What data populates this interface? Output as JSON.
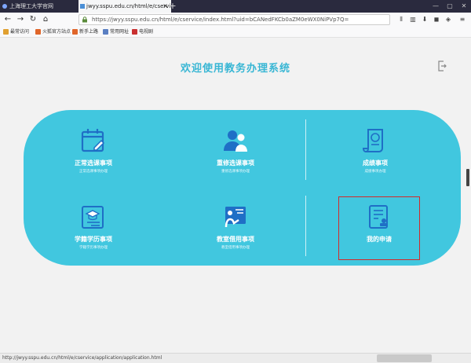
{
  "browser": {
    "tabs": [
      {
        "label": "上海理工大学官网"
      },
      {
        "label": "jwyy.sspu.edu.cn/html/e/cservice/"
      }
    ],
    "nav": {
      "back": "←",
      "forward": "→",
      "reload": "↻",
      "home": "⌂"
    },
    "url": "https://jwyy.sspu.edu.cn/html/e/cservice/index.html?uid=bCANedFKCb0aZM0eWX0NiPVp7Q=",
    "bookmarks": [
      {
        "label": "最常访问",
        "color": "#e0a030"
      },
      {
        "label": "火狐官方站点",
        "color": "#e0662a"
      },
      {
        "label": "新手上路",
        "color": "#e0662a"
      },
      {
        "label": "常用网址",
        "color": "#5a7fc2"
      },
      {
        "label": "电视剧",
        "color": "#c93030"
      }
    ]
  },
  "page": {
    "title": "欢迎使用教务办理系统",
    "logout_icon": "logout-icon",
    "cards": [
      {
        "name": "regular-enroll",
        "label": "正常选课事项",
        "desc": "正常选课事项办理",
        "icon": "calendar-edit-icon"
      },
      {
        "name": "retake-enroll",
        "label": "重修选课事项",
        "desc": "重修选课事项办理",
        "icon": "people-icon"
      },
      {
        "name": "grades",
        "label": "成绩事项",
        "desc": "成绩事项办理",
        "icon": "certificate-icon"
      },
      {
        "name": "student-status",
        "label": "学籍学历事项",
        "desc": "学籍学历事项办理",
        "icon": "graduation-cap-icon"
      },
      {
        "name": "classroom-use",
        "label": "教室借用事项",
        "desc": "教室借用事项办理",
        "icon": "presentation-icon"
      },
      {
        "name": "my-applications",
        "label": "我的申请",
        "desc": "",
        "icon": "document-stamp-icon"
      }
    ]
  },
  "status": {
    "link": "http://jwyy.sspu.edu.cn/html/e/cservice/application/application.html"
  },
  "colors": {
    "accent": "#38b6d4",
    "panel": "#41c7df",
    "highlight": "#d32a2a"
  }
}
